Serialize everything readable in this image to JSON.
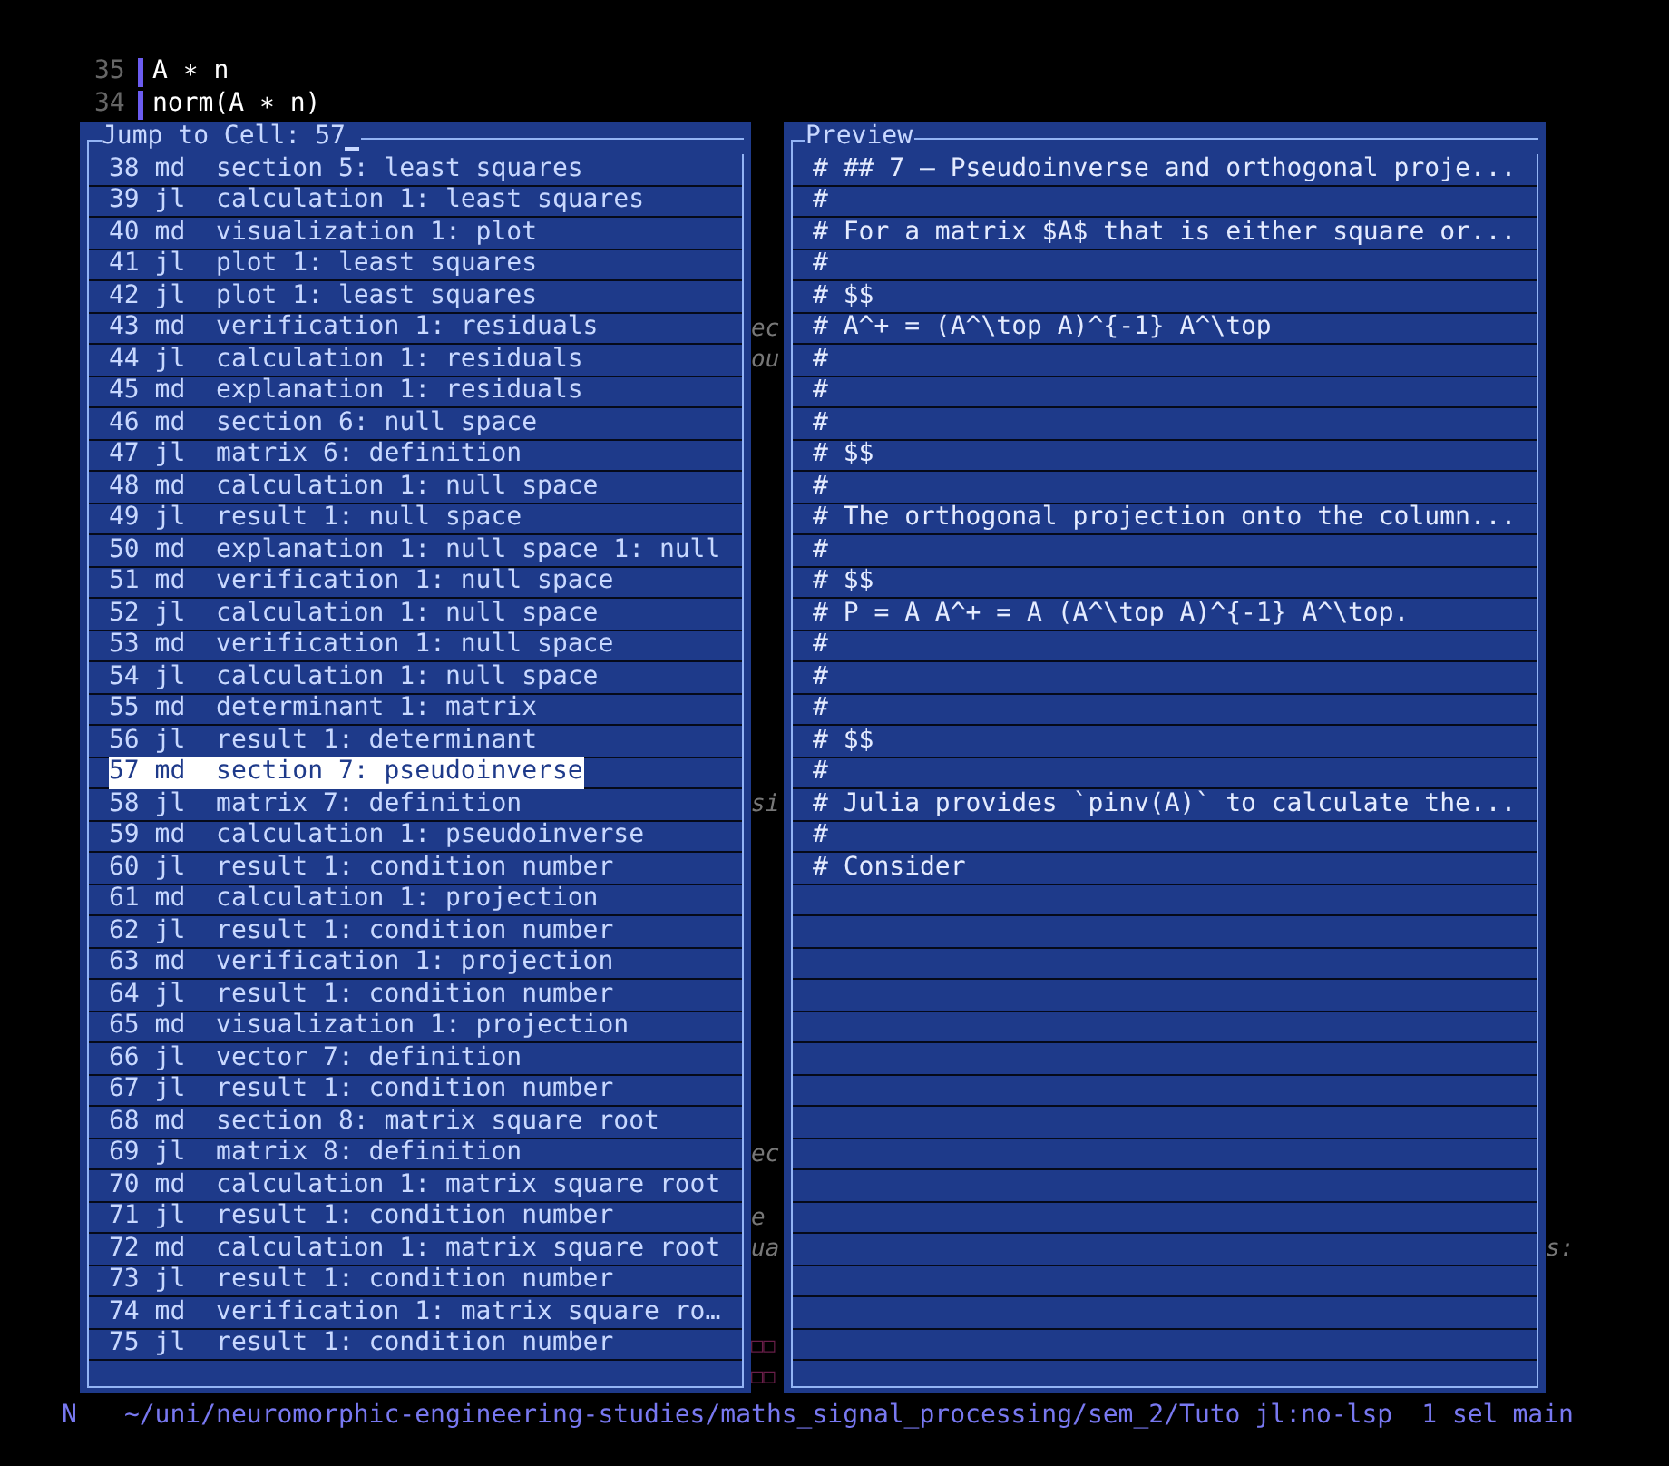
{
  "editor_lines": [
    {
      "number": "35",
      "code": "A ∗ n"
    },
    {
      "number": "34",
      "code": "norm(A ∗ n)"
    }
  ],
  "jump_panel": {
    "prompt": "Jump to Cell:",
    "query": "57",
    "footer_gutter": "□□",
    "cells": [
      {
        "number": "38",
        "lang": "md",
        "title": "section 5: least squares",
        "selected": false
      },
      {
        "number": "39",
        "lang": "jl",
        "title": "calculation 1: least squares",
        "selected": false
      },
      {
        "number": "40",
        "lang": "md",
        "title": "visualization 1: plot",
        "selected": false
      },
      {
        "number": "41",
        "lang": "jl",
        "title": "plot 1: least squares",
        "selected": false
      },
      {
        "number": "42",
        "lang": "jl",
        "title": "plot 1: least squares",
        "selected": false
      },
      {
        "number": "43",
        "lang": "md",
        "title": "verification 1: residuals",
        "selected": false,
        "behind_left": "ec"
      },
      {
        "number": "44",
        "lang": "jl",
        "title": "calculation 1: residuals",
        "selected": false,
        "behind_left": "ou"
      },
      {
        "number": "45",
        "lang": "md",
        "title": "explanation 1: residuals",
        "selected": false
      },
      {
        "number": "46",
        "lang": "md",
        "title": "section 6: null space",
        "selected": false
      },
      {
        "number": "47",
        "lang": "jl",
        "title": "matrix 6: definition",
        "selected": false
      },
      {
        "number": "48",
        "lang": "md",
        "title": "calculation 1: null space",
        "selected": false
      },
      {
        "number": "49",
        "lang": "jl",
        "title": "result 1: null space",
        "selected": false
      },
      {
        "number": "50",
        "lang": "md",
        "title": "explanation 1: null space 1: null",
        "selected": false
      },
      {
        "number": "51",
        "lang": "md",
        "title": "verification 1: null space",
        "selected": false
      },
      {
        "number": "52",
        "lang": "jl",
        "title": "calculation 1: null space",
        "selected": false
      },
      {
        "number": "53",
        "lang": "md",
        "title": "verification 1: null space",
        "selected": false
      },
      {
        "number": "54",
        "lang": "jl",
        "title": "calculation 1: null space",
        "selected": false
      },
      {
        "number": "55",
        "lang": "md",
        "title": "determinant 1: matrix",
        "selected": false
      },
      {
        "number": "56",
        "lang": "jl",
        "title": "result 1: determinant",
        "selected": false
      },
      {
        "number": "57",
        "lang": "md",
        "title": "section 7: pseudoinverse",
        "selected": true
      },
      {
        "number": "58",
        "lang": "jl",
        "title": "matrix 7: definition",
        "selected": false,
        "behind_left": "si"
      },
      {
        "number": "59",
        "lang": "md",
        "title": "calculation 1: pseudoinverse",
        "selected": false
      },
      {
        "number": "60",
        "lang": "jl",
        "title": "result 1: condition number",
        "selected": false
      },
      {
        "number": "61",
        "lang": "md",
        "title": "calculation 1: projection",
        "selected": false
      },
      {
        "number": "62",
        "lang": "jl",
        "title": "result 1: condition number",
        "selected": false
      },
      {
        "number": "63",
        "lang": "md",
        "title": "verification 1: projection",
        "selected": false
      },
      {
        "number": "64",
        "lang": "jl",
        "title": "result 1: condition number",
        "selected": false
      },
      {
        "number": "65",
        "lang": "md",
        "title": "visualization 1: projection",
        "selected": false
      },
      {
        "number": "66",
        "lang": "jl",
        "title": "vector 7: definition",
        "selected": false
      },
      {
        "number": "67",
        "lang": "jl",
        "title": "result 1: condition number",
        "selected": false
      },
      {
        "number": "68",
        "lang": "md",
        "title": "section 8: matrix square root",
        "selected": false
      },
      {
        "number": "69",
        "lang": "jl",
        "title": "matrix 8: definition",
        "selected": false,
        "behind_left": "ec"
      },
      {
        "number": "70",
        "lang": "md",
        "title": "calculation 1: matrix square root",
        "selected": false
      },
      {
        "number": "71",
        "lang": "jl",
        "title": "result 1: condition number",
        "selected": false,
        "behind_left": "e"
      },
      {
        "number": "72",
        "lang": "md",
        "title": "calculation 1: matrix square root",
        "selected": false,
        "behind_left": "ua",
        "behind_right": "s:"
      },
      {
        "number": "73",
        "lang": "jl",
        "title": "result 1: condition number",
        "selected": false
      },
      {
        "number": "74",
        "lang": "md",
        "title": "verification 1: matrix square ro…",
        "selected": false
      },
      {
        "number": "75",
        "lang": "jl",
        "title": "result 1: condition number",
        "selected": false,
        "behind_left": "□□"
      }
    ]
  },
  "preview": {
    "title": "Preview",
    "lines": [
      "# ## 7 — Pseudoinverse and orthogonal proje...",
      "#",
      "# For a matrix $A$ that is either square or...",
      "#",
      "# $$",
      "# A^+ = (A^\\top A)^{-1} A^\\top",
      "#",
      "#",
      "#",
      "# $$",
      "#",
      "# The orthogonal projection onto the column...",
      "#",
      "# $$",
      "# P = A A^+ = A (A^\\top A)^{-1} A^\\top.",
      "#",
      "#",
      "#",
      "# $$",
      "#",
      "# Julia provides `pinv(A)` to calculate the...",
      "#",
      "# Consider"
    ]
  },
  "status_bar": {
    "mode": "N",
    "path": "~/uni/neuromorphic-engineering-studies/maths_signal_processing/sem_2/Tuto",
    "language": "jl:no-lsp",
    "selections": "1 sel",
    "branch": "main"
  }
}
